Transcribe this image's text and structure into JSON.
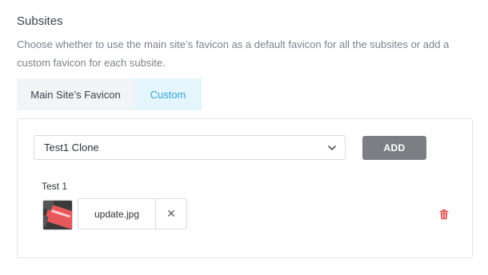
{
  "section": {
    "title": "Subsites",
    "description": "Choose whether to use the main site’s favicon as a default favicon for all the subsites or add a custom favicon for each subsite."
  },
  "tabs": [
    {
      "label": "Main Site’s Favicon",
      "active": false
    },
    {
      "label": "Custom",
      "active": true
    }
  ],
  "panel": {
    "subsite_select": {
      "selected": "Test1 Clone"
    },
    "add_label": "ADD",
    "entries": [
      {
        "site": "Test 1",
        "file_name": "update.jpg",
        "remove_glyph": "✕",
        "thumbnail_icon": "image-thumbnail-icon",
        "delete_icon": "trash-icon"
      }
    ]
  },
  "colors": {
    "accent": "#36a3d8",
    "active_tab_bg": "#e4f5fd",
    "button_bg": "#7b7e82",
    "delete": "#e05a5a"
  }
}
